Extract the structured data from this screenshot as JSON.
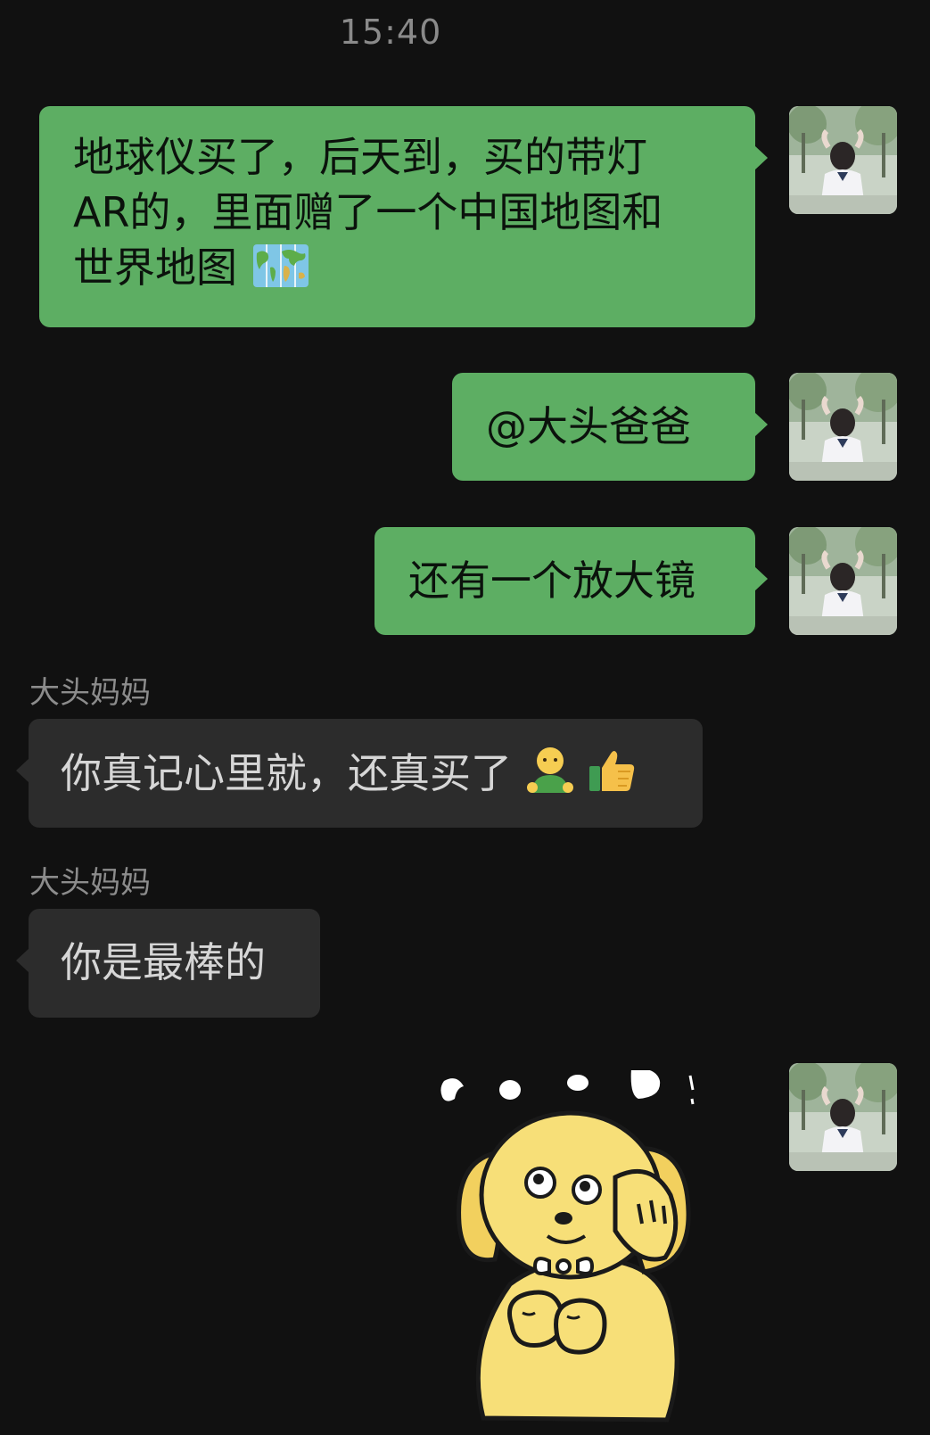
{
  "status": {
    "time": "15:40"
  },
  "messages": [
    {
      "direction": "outgoing",
      "line1": "地球仪买了，后天到，买的带灯",
      "line2": "AR的，里面赠了一个中国地图和",
      "line3": "世界地图",
      "emoji": "world-map-icon"
    },
    {
      "direction": "outgoing",
      "text": "@大头爸爸"
    },
    {
      "direction": "outgoing",
      "text": "还有一个放大镜"
    },
    {
      "direction": "incoming",
      "sender": "大头妈妈",
      "text": "你真记心里就，还真买了",
      "emojis": [
        "person-icon",
        "thumbs-up-icon"
      ]
    },
    {
      "direction": "incoming",
      "sender": "大头妈妈",
      "text": "你是最棒的"
    },
    {
      "direction": "outgoing",
      "type": "sticker",
      "sticker": "yellow-puppy-sticker"
    }
  ],
  "colors": {
    "background": "#111111",
    "outgoing_bubble": "#5dae63",
    "incoming_bubble": "#2c2c2c",
    "sender_name": "#8c8c8c",
    "timestamp": "#8a8a8a"
  }
}
